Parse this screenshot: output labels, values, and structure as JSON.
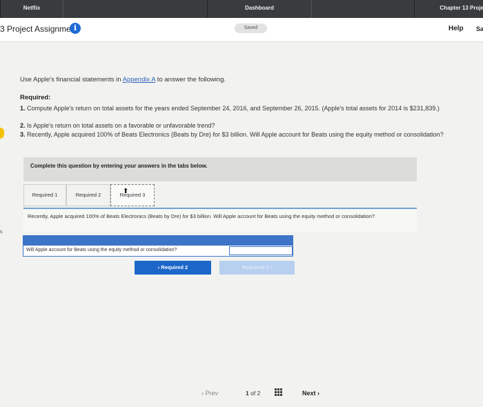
{
  "topbar": {
    "left_tab": "Netflix",
    "center_tab": "Dashboard",
    "right_tab": "Chapter 13 Proje"
  },
  "header": {
    "assignment_title": "3 Project Assignment",
    "saved_label": "Saved",
    "help_label": "Help",
    "save_label": "Sa"
  },
  "side": {
    "left_fragment": "s"
  },
  "content": {
    "intro_prefix": "Use Apple's financial statements in ",
    "appendix_link": "Appendix A",
    "intro_suffix": " to answer the following.",
    "required_heading": "Required:",
    "requirement_1_num": "1.",
    "requirement_1_text": "Compute Apple's return on total assets for the years ended September 24, 2016, and September 26, 2015. (Apple's total assets for 2014 is $231,839.)",
    "requirement_2_num": "2.",
    "requirement_2_text": "Is Apple's return on total assets on a favorable or unfavorable trend?",
    "requirement_3_num": "3.",
    "requirement_3_text": "Recently, Apple acquired 100% of Beats Electronics (Beats by Dre) for $3 billion. Will Apple account for Beats using the equity method or consolidation?"
  },
  "instruction": "Complete this question by entering your answers in the tabs below.",
  "tabs": [
    {
      "label": "Required 1"
    },
    {
      "label": "Required 2"
    },
    {
      "label": "Required 3"
    }
  ],
  "question": "Recently, Apple acquired 100% of Beats Electronics (Beats by Dre) for $3 billion. Will Apple account for Beats using the equity method or consolidation?",
  "answer": {
    "label": "Will Apple account for Beats using the equity method or consolidation?",
    "value": ""
  },
  "nav_buttons": {
    "prev_label": "‹  Required 2",
    "next_label": "Required 3  ›"
  },
  "footer": {
    "prev_label": "‹  Prev",
    "page_current": "1",
    "page_of": "of",
    "page_total": "2",
    "next_label": "Next  ›"
  },
  "colors": {
    "topbar": "#3a3b3d",
    "accent_blue": "#1c67c9",
    "disabled_blue": "#b8d0ef",
    "marker_yellow": "#f2c200"
  },
  "icons": [
    "info-icon",
    "grid-icon",
    "cursor-icon"
  ]
}
